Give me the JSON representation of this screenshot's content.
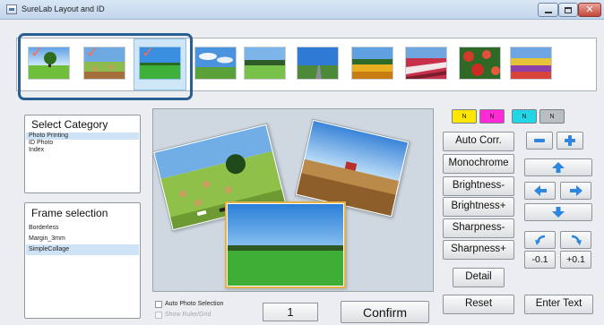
{
  "window": {
    "title": "SureLab Layout and ID",
    "controls": [
      "minimize-icon",
      "maximize-icon",
      "close-icon"
    ]
  },
  "thumbnails": {
    "selected_count": 3,
    "items": [
      {
        "scene": "single-tree-field",
        "checked": true
      },
      {
        "scene": "meadow-hay-bales",
        "checked": true
      },
      {
        "scene": "green-field-horizon",
        "checked": true,
        "selected": true
      },
      {
        "scene": "field-under-clouds",
        "checked": false
      },
      {
        "scene": "tree-line-field",
        "checked": false
      },
      {
        "scene": "road-landscape",
        "checked": false
      },
      {
        "scene": "sunflower-field",
        "checked": false
      },
      {
        "scene": "striped-flower-hills",
        "checked": false
      },
      {
        "scene": "red-flower-patches",
        "checked": false
      },
      {
        "scene": "flower-fields",
        "checked": false
      }
    ]
  },
  "category": {
    "title": "Select Category",
    "items": [
      "Photo Printing",
      "ID Photo",
      "Index"
    ],
    "selected_index": 0
  },
  "frame": {
    "title": "Frame selection",
    "items": [
      "Borderless",
      "Margin_3mm",
      "SimpleCollage"
    ],
    "selected_index": 2
  },
  "color_swatches": [
    {
      "label": "N",
      "color": "#ffe600"
    },
    {
      "label": "N",
      "color": "#ff2ad4"
    },
    {
      "label": "N",
      "color": "#22d6e6"
    },
    {
      "label": "N",
      "color": "#b9bec3"
    }
  ],
  "adjust": {
    "auto_corr": "Auto Corr.",
    "monochrome": "Monochrome",
    "brightness_minus": "Brightness-",
    "brightness_plus": "Brightness+",
    "sharpness_minus": "Sharpness-",
    "sharpness_plus": "Sharpness+",
    "detail": "Detail",
    "reset": "Reset",
    "enter_text": "Enter Text"
  },
  "nudge": {
    "minus": "-0.1",
    "plus": "+0.1"
  },
  "bottom": {
    "auto_photo_selection": "Auto Photo Selection",
    "auto_photo_selection_checked": false,
    "show_ruler_grid": "Show Ruler/Grid",
    "show_ruler_grid_enabled": false,
    "copies": "1",
    "confirm": "Confirm"
  },
  "colors": {
    "title_bar": "#c9daee",
    "accent": "#2b5e90",
    "window_bg": "#ebedf0",
    "checkmark": "#ff6a4d",
    "arrow_blue": "#2e86de"
  }
}
